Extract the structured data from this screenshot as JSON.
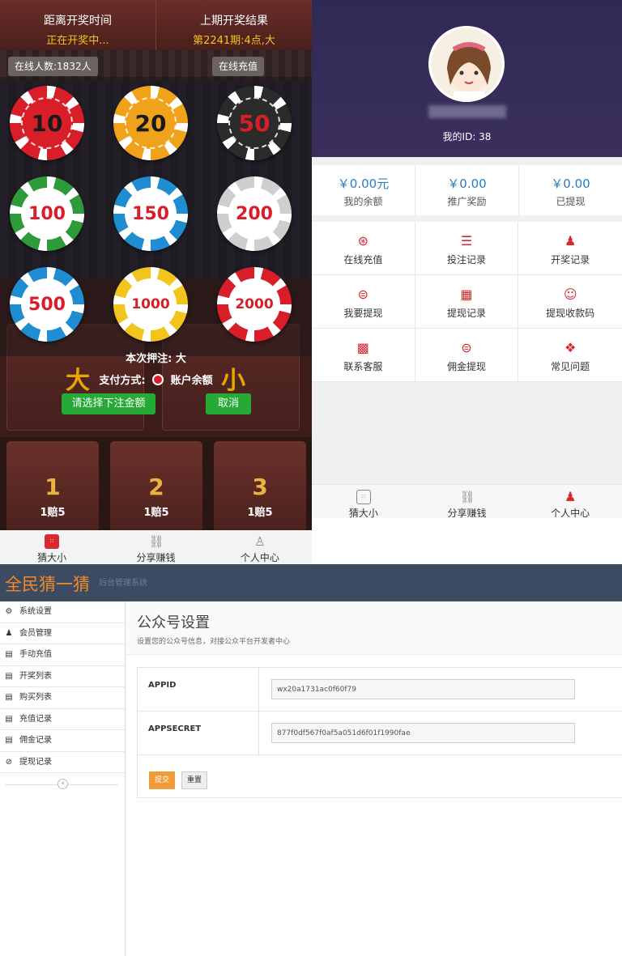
{
  "game": {
    "header": {
      "left_title": "距离开奖时间",
      "left_status": "正在开奖中...",
      "right_title": "上期开奖结果",
      "right_result": "第2241期:4点,大"
    },
    "online_count": "在线人数:1832人",
    "recharge_label": "在线充值",
    "chips": [
      "10",
      "20",
      "50",
      "100",
      "150",
      "200",
      "500",
      "1000",
      "2000"
    ],
    "big_label": "大",
    "small_label": "小",
    "bet_text": "本次押注: 大",
    "pay_label": "支付方式:",
    "pay_option": "账户余额",
    "select_amount_button": "请选择下注金额",
    "cancel_button": "取消",
    "numbers": [
      {
        "n": "1",
        "odds": "1赔5"
      },
      {
        "n": "2",
        "odds": "1赔5"
      },
      {
        "n": "3",
        "odds": "1赔5"
      }
    ],
    "tabs": [
      "猜大小",
      "分享赚钱",
      "个人中心"
    ]
  },
  "user": {
    "user_id": "我的ID: 38",
    "stats": [
      {
        "value": "￥0.00元",
        "label": "我的余额"
      },
      {
        "value": "￥0.00",
        "label": "推广奖励"
      },
      {
        "value": "￥0.00",
        "label": "已提现"
      }
    ],
    "menu": [
      {
        "label": "在线充值",
        "icon": "recharge-icon"
      },
      {
        "label": "投注记录",
        "icon": "list-icon"
      },
      {
        "label": "开奖记录",
        "icon": "users-icon"
      },
      {
        "label": "我要提现",
        "icon": "coin-icon"
      },
      {
        "label": "提现记录",
        "icon": "records-icon"
      },
      {
        "label": "提现收款码",
        "icon": "smile-icon"
      },
      {
        "label": "联系客服",
        "icon": "qr-icon"
      },
      {
        "label": "佣金提现",
        "icon": "coin-icon"
      },
      {
        "label": "常见问题",
        "icon": "grid-icon"
      }
    ],
    "tabs": [
      "猜大小",
      "分享赚钱",
      "个人中心"
    ]
  },
  "admin": {
    "logo": "全民猜一猜",
    "subtitle": "后台管理系统",
    "sidebar": [
      {
        "label": "系统设置",
        "icon": "gear-icon"
      },
      {
        "label": "会员管理",
        "icon": "user-icon"
      },
      {
        "label": "手动充值",
        "icon": "doc-icon"
      },
      {
        "label": "开奖列表",
        "icon": "doc-icon"
      },
      {
        "label": "购买列表",
        "icon": "doc-icon"
      },
      {
        "label": "充值记录",
        "icon": "doc-icon"
      },
      {
        "label": "佣金记录",
        "icon": "doc-icon"
      },
      {
        "label": "提现记录",
        "icon": "ban-icon"
      }
    ],
    "page_title": "公众号设置",
    "page_desc": "设置您的公众号信息，对接公众平台开发者中心",
    "fields": [
      {
        "label": "APPID",
        "value": "wx20a1731ac0f60f79"
      },
      {
        "label": "APPSECRET",
        "value": "877f0df567f0af5a051d6f01f1990fae"
      }
    ],
    "submit_button": "提交",
    "reset_button": "重置"
  },
  "colors": {
    "accent_gold": "#f3c31a",
    "green_button": "#26a935",
    "user_header": "#2f2a55",
    "admin_top": "#3c4b62",
    "admin_logo": "#f08a24",
    "submit": "#f19a38"
  }
}
